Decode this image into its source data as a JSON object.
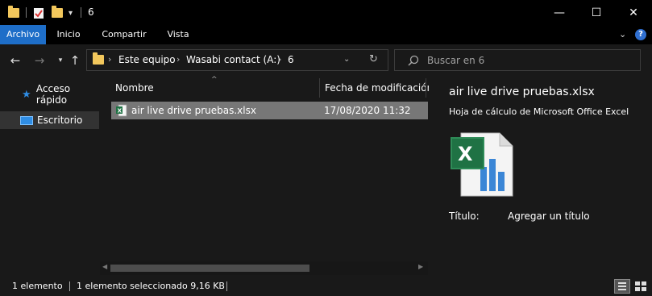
{
  "window": {
    "title": "6",
    "controls": {
      "minimize": "—",
      "maximize": "☐",
      "close": "✕"
    }
  },
  "ribbon": {
    "tabs": [
      {
        "label": "Archivo",
        "active": true
      },
      {
        "label": "Inicio"
      },
      {
        "label": "Compartir"
      },
      {
        "label": "Vista"
      }
    ]
  },
  "address": {
    "breadcrumbs": [
      "Este equipo",
      "Wasabi contact (A:)",
      "6"
    ]
  },
  "search": {
    "placeholder": "Buscar en 6"
  },
  "navpane": {
    "items": [
      {
        "label": "Acceso rápido",
        "icon": "star-icon"
      },
      {
        "label": "Escritorio",
        "icon": "desktop-icon",
        "selected": true
      }
    ]
  },
  "filelist": {
    "columns": {
      "name": "Nombre",
      "modified": "Fecha de modificación"
    },
    "files": [
      {
        "name": "air live drive pruebas.xlsx",
        "modified": "17/08/2020 11:32",
        "icon": "excel-file-icon",
        "selected": true
      }
    ]
  },
  "preview": {
    "filename": "air live drive pruebas.xlsx",
    "filetype": "Hoja de cálculo de Microsoft Office Excel",
    "title_label": "Título:",
    "title_value": "Agregar un título"
  },
  "status": {
    "item_count": "1 elemento",
    "selection": "1 elemento seleccionado  9,16 KB"
  },
  "colors": {
    "accent": "#1e6ec8",
    "background": "#191919",
    "selection": "#777777",
    "folder": "#f2c75c",
    "excel_green": "#1f7244"
  }
}
